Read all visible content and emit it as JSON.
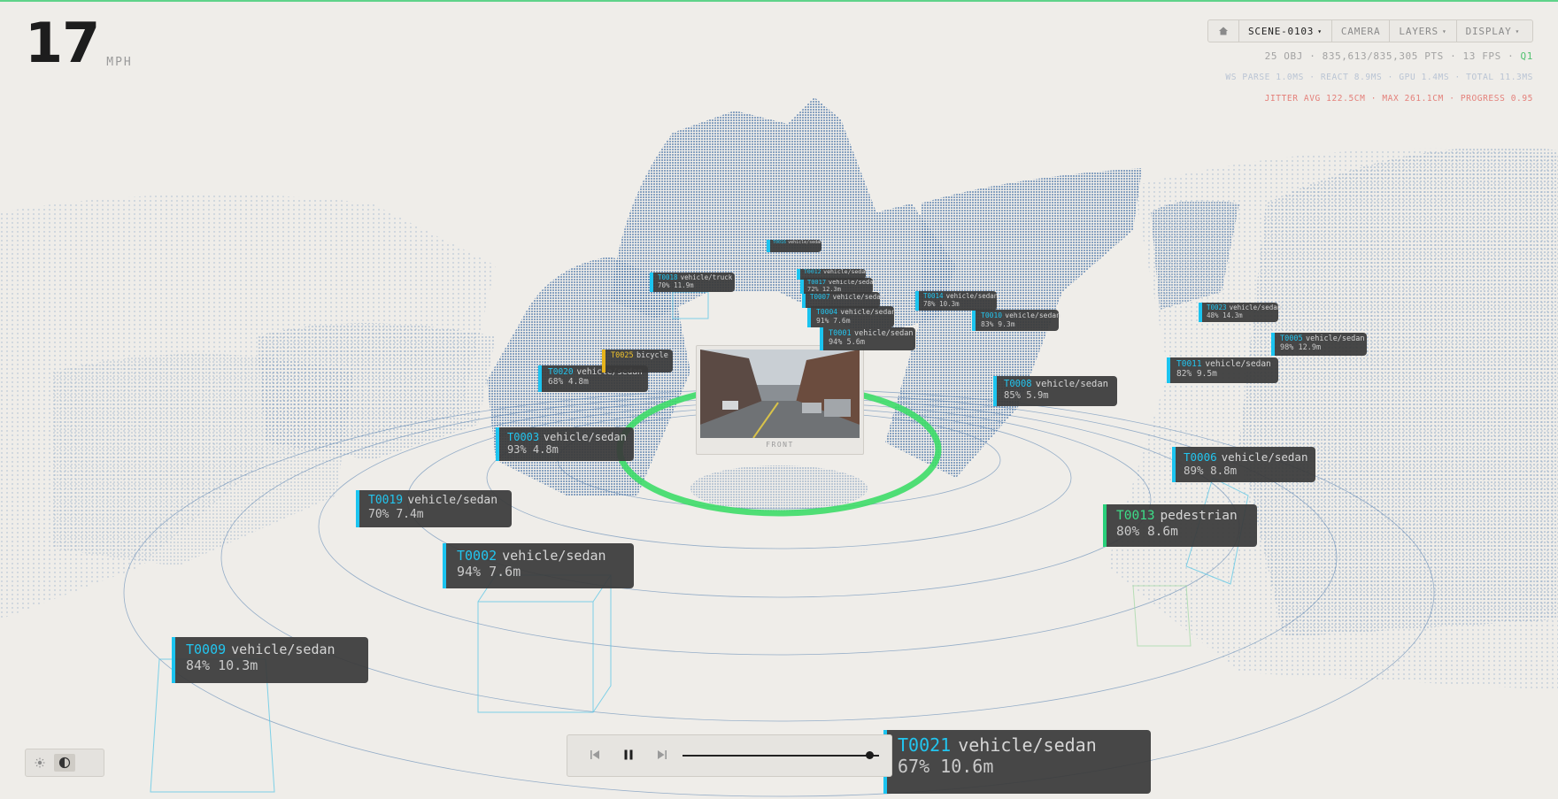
{
  "speed": {
    "value": "17",
    "unit": "MPH"
  },
  "toolbar": {
    "scene": "SCENE-0103",
    "camera": "CAMERA",
    "layers": "LAYERS",
    "display": "DISPLAY",
    "caret": "▾"
  },
  "stats": {
    "line1": "25 OBJ · 835,613/835,305 PTS · 13 FPS · ",
    "quality": "Q1",
    "line2": "WS PARSE 1.0MS · REACT 8.9MS · GPU 1.4MS · TOTAL 11.3MS",
    "line3": "JITTER AVG 122.5CM · MAX 261.1CM · PROGRESS 0.95"
  },
  "camera": {
    "label": "FRONT"
  },
  "playback": {
    "progress": 0.95
  },
  "colors": {
    "background": "#efede9",
    "point_cloud": "#3f6fa6",
    "ego_ring": "#3ddc68",
    "label_accent": "#1bc4f0",
    "pedestrian_accent": "#28d07a",
    "bicycle_accent": "#e5b31c"
  },
  "labels": [
    {
      "id": "T0001",
      "cls": "vehicle/sedan",
      "conf": "94%",
      "dist": "5.6m"
    },
    {
      "id": "T0002",
      "cls": "vehicle/sedan",
      "conf": "94%",
      "dist": "7.6m"
    },
    {
      "id": "T0003",
      "cls": "vehicle/sedan",
      "conf": "93%",
      "dist": "4.8m"
    },
    {
      "id": "T0004",
      "cls": "vehicle/sedan",
      "conf": "91%",
      "dist": "7.6m"
    },
    {
      "id": "T0005",
      "cls": "vehicle/sedan",
      "conf": "98%",
      "dist": "12.9m"
    },
    {
      "id": "T0006",
      "cls": "vehicle/sedan",
      "conf": "89%",
      "dist": "8.8m"
    },
    {
      "id": "T0007",
      "cls": "vehicle/sedan",
      "conf": "",
      "dist": ""
    },
    {
      "id": "T0008",
      "cls": "vehicle/sedan",
      "conf": "85%",
      "dist": "5.9m"
    },
    {
      "id": "T0009",
      "cls": "vehicle/sedan",
      "conf": "84%",
      "dist": "10.3m"
    },
    {
      "id": "T0010",
      "cls": "vehicle/sedan",
      "conf": "83%",
      "dist": "9.3m"
    },
    {
      "id": "T0011",
      "cls": "vehicle/sedan",
      "conf": "82%",
      "dist": "9.5m"
    },
    {
      "id": "T0012",
      "cls": "vehicle/sedan",
      "conf": "",
      "dist": ""
    },
    {
      "id": "T0013",
      "cls": "pedestrian",
      "conf": "80%",
      "dist": "8.6m"
    },
    {
      "id": "T0014",
      "cls": "vehicle/sedan",
      "conf": "78%",
      "dist": "10.3m"
    },
    {
      "id": "T0016",
      "cls": "vehicle/sedan",
      "conf": "",
      "dist": ""
    },
    {
      "id": "T0017",
      "cls": "vehicle/sedan",
      "conf": "72%",
      "dist": "12.3m"
    },
    {
      "id": "T0018",
      "cls": "vehicle/truck",
      "conf": "70%",
      "dist": "11.9m"
    },
    {
      "id": "T0019",
      "cls": "vehicle/sedan",
      "conf": "70%",
      "dist": "7.4m"
    },
    {
      "id": "T0020",
      "cls": "vehicle/sedan",
      "conf": "68%",
      "dist": "4.8m"
    },
    {
      "id": "T0021",
      "cls": "vehicle/sedan",
      "conf": "67%",
      "dist": "10.6m"
    },
    {
      "id": "T0023",
      "cls": "vehicle/sedan",
      "conf": "48%",
      "dist": "14.3m"
    },
    {
      "id": "T0025",
      "cls": "bicycle",
      "conf": "",
      "dist": ""
    }
  ]
}
